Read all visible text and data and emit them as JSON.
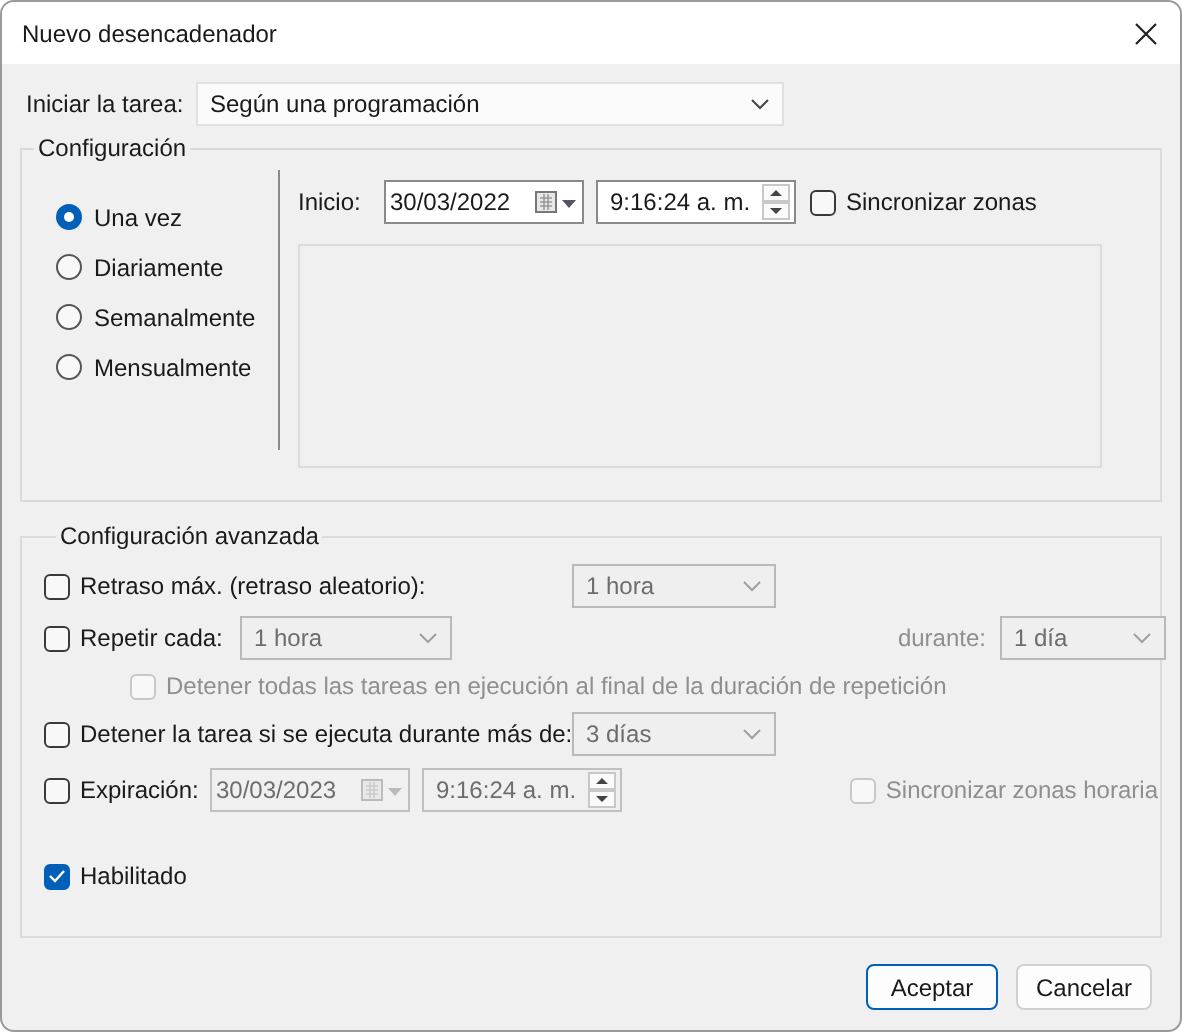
{
  "window": {
    "title": "Nuevo desencadenador"
  },
  "start_task": {
    "label": "Iniciar la tarea:",
    "value": "Según una programación"
  },
  "settings": {
    "title": "Configuración",
    "frequency": [
      {
        "label": "Una vez",
        "selected": true
      },
      {
        "label": "Diariamente",
        "selected": false
      },
      {
        "label": "Semanalmente",
        "selected": false
      },
      {
        "label": "Mensualmente",
        "selected": false
      }
    ],
    "start": {
      "label": "Inicio:",
      "date": "30/03/2022",
      "time": "9:16:24 a. m."
    },
    "sync_zones": {
      "label": "Sincronizar zonas",
      "checked": false
    }
  },
  "advanced": {
    "title": "Configuración avanzada",
    "max_delay": {
      "label": "Retraso máx. (retraso aleatorio):",
      "checked": false,
      "value": "1 hora",
      "disabled": true
    },
    "repeat": {
      "label": "Repetir cada:",
      "checked": false,
      "value": "1 hora",
      "disabled": true,
      "duration_label": "durante:",
      "duration_value": "1 día"
    },
    "stop_all": {
      "label": "Detener todas las tareas en ejecución al final de la duración de repetición",
      "checked": false,
      "disabled": true
    },
    "stop_after": {
      "label": "Detener la tarea si se ejecuta durante más de:",
      "checked": false,
      "value": "3 días",
      "disabled": true
    },
    "expiration": {
      "label": "Expiración:",
      "checked": false,
      "date": "30/03/2023",
      "time": "9:16:24 a. m.",
      "disabled": true
    },
    "expiration_sync": {
      "label": "Sincronizar zonas horaria",
      "checked": false,
      "disabled": true
    },
    "enabled": {
      "label": "Habilitado",
      "checked": true
    }
  },
  "buttons": [
    {
      "label": "Aceptar",
      "default": true
    },
    {
      "label": "Cancelar",
      "default": false
    }
  ]
}
